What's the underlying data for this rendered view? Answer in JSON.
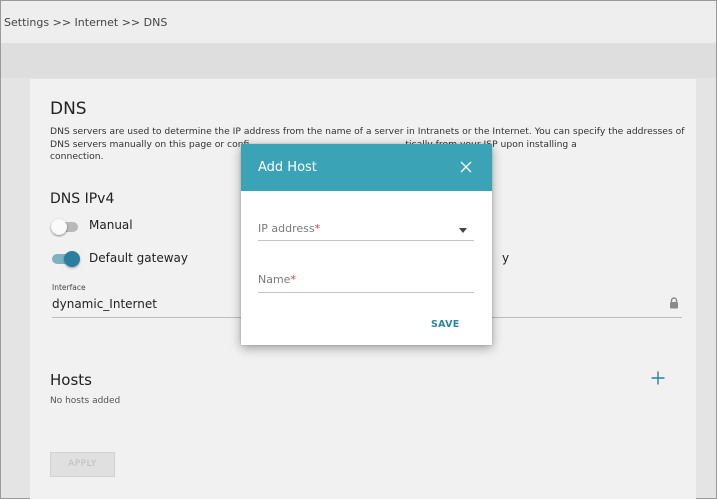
{
  "breadcrumb": "Settings >> Internet >> DNS",
  "dns": {
    "title": "DNS",
    "description_visible_start": "DNS servers are used to determine the IP address from the name of a server in Intranets or the Internet. You can specify the addresses of",
    "description_line2_start": "DNS servers manually on this page or confi",
    "description_line2_end": "tically from your ISP upon installing a",
    "description_line3": "connection."
  },
  "ipv4": {
    "title": "DNS IPv4",
    "manual_label": "Manual",
    "default_gateway_label": "Default gateway",
    "stray_text": "y",
    "interface_caption": "Interface",
    "interface_value": "dynamic_Internet"
  },
  "hosts": {
    "title": "Hosts",
    "empty_text": "No hosts added"
  },
  "apply_label": "APPLY",
  "modal": {
    "title": "Add Host",
    "ip_label": "IP address",
    "name_label": "Name",
    "required_mark": "*",
    "save_label": "SAVE"
  },
  "colors": {
    "accent": "#3aa3b6",
    "toggle_on": "#2a7fa0",
    "required": "#e53935"
  },
  "icons": {
    "close": "close-icon",
    "lock": "lock-icon",
    "plus": "plus-icon",
    "dropdown": "chevron-down-icon"
  }
}
